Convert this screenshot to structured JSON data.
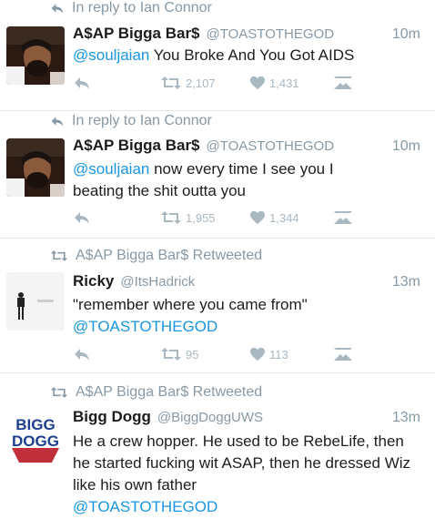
{
  "tweets": [
    {
      "context": "In reply to Ian Connor",
      "name": "A$AP Bigga Bar$",
      "handle": "@TOASTOTHEGOD",
      "time": "10m",
      "mention": "@souljaian",
      "text": " You Broke And You Got AIDS",
      "retweets": "2,107",
      "likes": "1,431"
    },
    {
      "context": "In reply to Ian Connor",
      "name": "A$AP Bigga Bar$",
      "handle": "@TOASTOTHEGOD",
      "time": "10m",
      "mention": "@souljaian",
      "text": " now every time I see you I beating the shit outta you",
      "retweets": "1,955",
      "likes": "1,344"
    },
    {
      "context": "A$AP Bigga Bar$ Retweeted",
      "name": "Ricky",
      "handle": "@ItsHadrick",
      "time": "13m",
      "text": "\"remember where you came from\"",
      "mention": "@TOASTOTHEGOD",
      "retweets": "95",
      "likes": "113"
    },
    {
      "context": "A$AP Bigga Bar$ Retweeted",
      "name": "Bigg Dogg",
      "handle": "@BiggDoggUWS",
      "time": "13m",
      "text": "He a crew hopper. He used to be RebeLife, then he started fucking wit ASAP, then he dressed Wiz like his own father",
      "mention": "@TOASTOTHEGOD",
      "avatar_text_1": "BIGG",
      "avatar_text_2": "DOGG"
    }
  ],
  "icons": {
    "reply": "reply-arrow-icon",
    "retweet": "retweet-icon",
    "like": "heart-icon",
    "dm": "envelope-icon"
  },
  "colors": {
    "link": "#1b95e0",
    "muted": "#8899a6",
    "icon": "#aab8c2"
  }
}
